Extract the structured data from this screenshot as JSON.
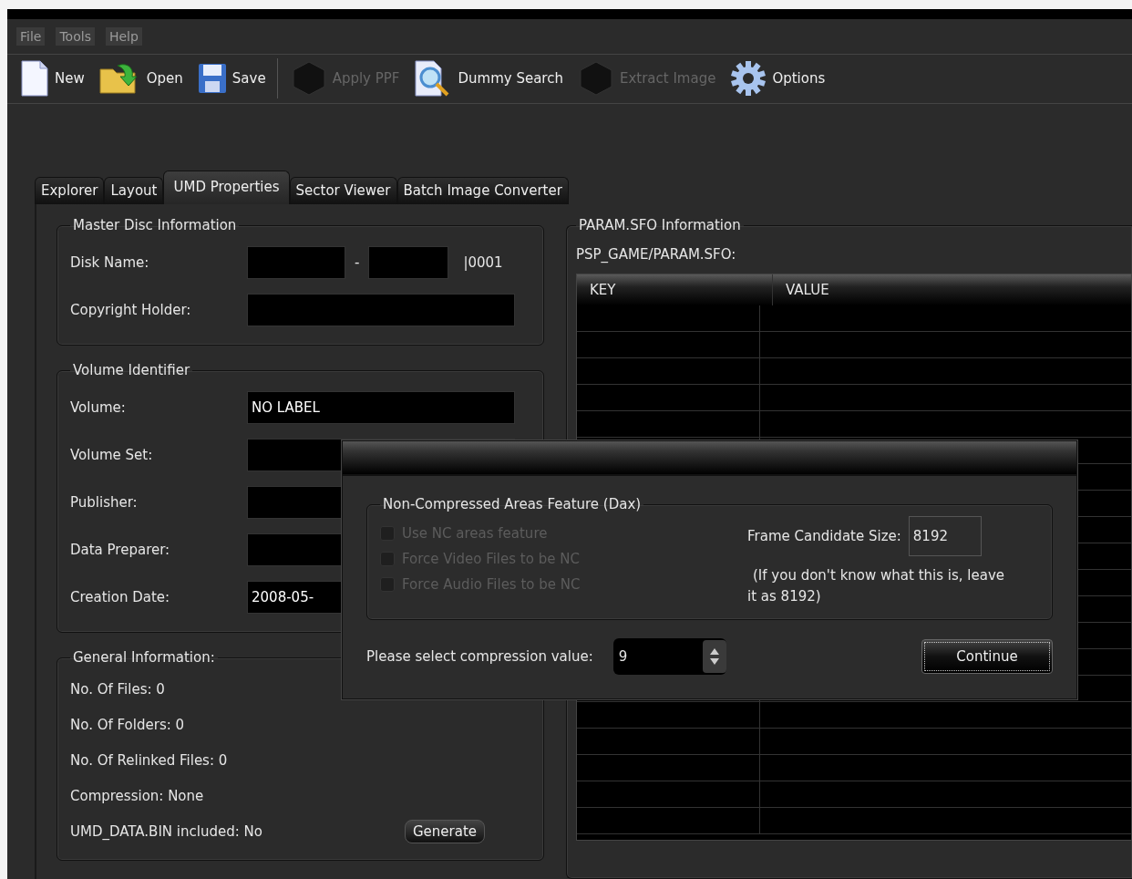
{
  "menu": [
    {
      "label": "File",
      "disabled": true
    },
    {
      "label": "Tools",
      "disabled": true
    },
    {
      "label": "Help",
      "disabled": true
    }
  ],
  "toolbar": [
    [
      {
        "label": "New",
        "kind": "page",
        "disabled": false
      },
      {
        "label": "Open",
        "kind": "folder",
        "disabled": false
      },
      {
        "label": "Save",
        "kind": "disk",
        "disabled": false
      }
    ],
    [
      {
        "label": "Apply PPF",
        "kind": "blank",
        "disabled": true
      },
      {
        "label": "Dummy Search",
        "kind": "search",
        "disabled": false
      },
      {
        "label": "Extract Image",
        "kind": "blank",
        "disabled": true
      },
      {
        "label": "Options",
        "kind": "gear",
        "disabled": false
      }
    ]
  ],
  "tabs": [
    {
      "label": "Explorer",
      "selected": false
    },
    {
      "label": "Layout",
      "selected": false
    },
    {
      "label": "UMD Properties",
      "selected": true
    },
    {
      "label": "Sector Viewer",
      "selected": false
    },
    {
      "label": "Batch Image Converter",
      "selected": false
    }
  ],
  "master_disc": {
    "title": "Master Disc Information",
    "disk_name": {
      "label": "Disk Name:",
      "separator": "-",
      "suffix": "|0001"
    },
    "copyright_holder": {
      "label": "Copyright Holder:"
    }
  },
  "volume_identifier": {
    "title": "Volume Identifier",
    "fields": [
      {
        "label": "Volume:",
        "value": "NO LABEL"
      },
      {
        "label": "Volume Set:"
      },
      {
        "label": "Publisher:"
      },
      {
        "label": "Data Preparer:"
      },
      {
        "label": "Creation Date:",
        "value": "2008-05-"
      }
    ]
  },
  "general_information": {
    "title": "General Information:",
    "lines": [
      "No. Of Files: 0",
      "No. Of Folders: 0",
      "No. Of Relinked Files: 0",
      "Compression: None",
      "UMD_DATA.BIN included: No"
    ],
    "button": "Generate"
  },
  "param_sfo": {
    "title": "PARAM.SFO Information",
    "path": "PSP_GAME/PARAM.SFO:",
    "columns": [
      "KEY",
      "VALUE"
    ]
  },
  "dialog": {
    "group_title": "Non-Compressed Areas Feature (Dax)",
    "checkboxes": [
      {
        "label": "Use NC areas feature",
        "checked": false,
        "disabled": true
      },
      {
        "label": "Force Video Files to be NC",
        "checked": false,
        "disabled": true
      },
      {
        "label": "Force Audio Files to be NC",
        "checked": false,
        "disabled": true
      }
    ],
    "frame_size": {
      "label": "Frame Candidate Size:",
      "value": "8192"
    },
    "hint": "(If you don't know what this is, leave it as 8192)",
    "compression": {
      "label": "Please select compression value:",
      "value": "9"
    },
    "continue": {
      "label": "Continue",
      "focused": true
    }
  }
}
